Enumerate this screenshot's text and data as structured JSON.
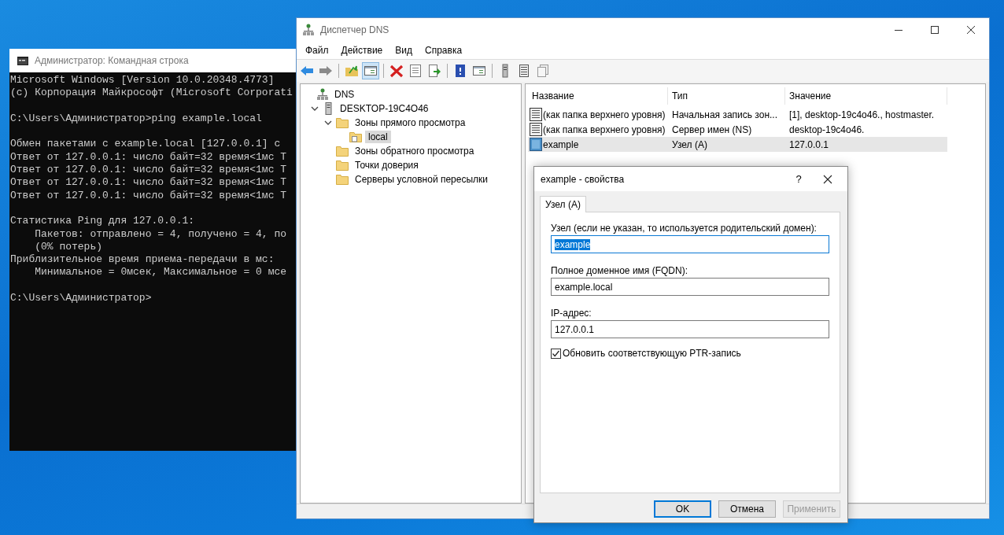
{
  "cmd_window": {
    "title": "Администратор: Командная строка",
    "blocks": [
      [
        "Microsoft Windows [Version 10.0.20348.4773]",
        "(c) Корпорация Майкрософт (Microsoft Corporati"
      ],
      [
        "C:\\Users\\Администратор>ping example.local"
      ],
      [
        "Обмен пакетами с example.local [127.0.0.1] с",
        "Ответ от 127.0.0.1: число байт=32 время<1мс Т",
        "Ответ от 127.0.0.1: число байт=32 время<1мс Т",
        "Ответ от 127.0.0.1: число байт=32 время<1мс Т",
        "Ответ от 127.0.0.1: число байт=32 время<1мс Т"
      ],
      [
        "Статистика Ping для 127.0.0.1:",
        "    Пакетов: отправлено = 4, получено = 4, по",
        "    (0% потерь)",
        "Приблизительное время приема-передачи в мс:",
        "    Минимальное = 0мсек, Максимальное = 0 мсе"
      ],
      [
        "C:\\Users\\Администратор>"
      ]
    ]
  },
  "dns_window": {
    "title": "Диспетчер DNS",
    "menu": [
      "Файл",
      "Действие",
      "Вид",
      "Справка"
    ],
    "toolbar": [
      {
        "kind": "back",
        "pressed": false
      },
      {
        "kind": "forward",
        "pressed": false
      },
      {
        "kind": "sep"
      },
      {
        "kind": "folder-up",
        "pressed": false
      },
      {
        "kind": "tree-toggle",
        "pressed": true
      },
      {
        "kind": "sep"
      },
      {
        "kind": "delete",
        "pressed": false
      },
      {
        "kind": "properties",
        "pressed": false
      },
      {
        "kind": "export",
        "pressed": false
      },
      {
        "kind": "sep"
      },
      {
        "kind": "help",
        "pressed": false
      },
      {
        "kind": "action-pane",
        "pressed": false
      },
      {
        "kind": "sep"
      },
      {
        "kind": "server",
        "pressed": false
      },
      {
        "kind": "list",
        "pressed": false
      },
      {
        "kind": "copy",
        "pressed": false
      }
    ],
    "tree": [
      {
        "label": "DNS",
        "kind": "root",
        "selected": false,
        "children": [
          {
            "label": "DESKTOP-19C4O46",
            "kind": "server",
            "selected": false,
            "expanded": true,
            "children": [
              {
                "label": "Зоны прямого просмотра",
                "kind": "folder",
                "selected": false,
                "expanded": true,
                "children": [
                  {
                    "label": "local",
                    "kind": "zone",
                    "selected": true
                  }
                ]
              },
              {
                "label": "Зоны обратного просмотра",
                "kind": "folder",
                "selected": false
              },
              {
                "label": "Точки доверия",
                "kind": "folder",
                "selected": false
              },
              {
                "label": "Серверы условной пересылки",
                "kind": "folder",
                "selected": false
              }
            ]
          }
        ]
      }
    ],
    "list": {
      "columns": [
        "Название",
        "Тип",
        "Значение"
      ],
      "rows": [
        {
          "name": "(как папка верхнего уровня)",
          "type": "Начальная запись зон...",
          "value": "[1], desktop-19c4o46., hostmaster.",
          "kind": "record",
          "selected": false
        },
        {
          "name": "(как папка верхнего уровня)",
          "type": "Сервер имен (NS)",
          "value": "desktop-19c4o46.",
          "kind": "record",
          "selected": false
        },
        {
          "name": "example",
          "type": "Узел (A)",
          "value": "127.0.0.1",
          "kind": "host",
          "selected": true
        }
      ]
    }
  },
  "dialog": {
    "title": "example - свойства",
    "help": "?",
    "tabs": [
      {
        "label": "Узел (A)",
        "selected": true
      }
    ],
    "fields": [
      {
        "label": "Узел (если не указан, то используется родительский домен):",
        "value": "example",
        "focused": true
      },
      {
        "label": "Полное доменное имя (FQDN):",
        "value": "example.local",
        "focused": false
      },
      {
        "label": "IP-адрес:",
        "value": "127.0.0.1",
        "focused": false
      }
    ],
    "checkbox": {
      "label": "Обновить соответствующую PTR-запись",
      "checked": true
    },
    "buttons": [
      {
        "label": "OK",
        "default": true,
        "disabled": false
      },
      {
        "label": "Отмена",
        "default": false,
        "disabled": false
      },
      {
        "label": "Применить",
        "default": false,
        "disabled": true
      }
    ]
  }
}
